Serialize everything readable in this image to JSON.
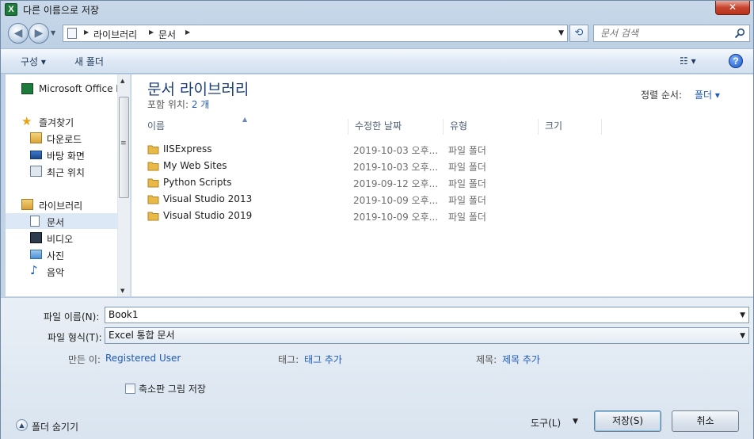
{
  "window": {
    "title": "다른 이름으로 저장",
    "app_icon_letter": "X",
    "close_glyph": "✕"
  },
  "address": {
    "breadcrumbs": [
      "라이브러리",
      "문서"
    ],
    "search_placeholder": "문서 검색"
  },
  "toolbar": {
    "organize_label": "구성 ▾",
    "new_folder_label": "새 폴더",
    "view_label": "☷ ▾",
    "help_label": "?"
  },
  "nav_pane": {
    "items": [
      {
        "label": "Microsoft Office Excel",
        "icon": "excel-icon"
      },
      {
        "label": "즐겨찾기",
        "icon": "star-icon"
      },
      {
        "label": "다운로드",
        "icon": "download-icon"
      },
      {
        "label": "바탕 화면",
        "icon": "desktop-icon"
      },
      {
        "label": "최근 위치",
        "icon": "recent-places-icon"
      },
      {
        "label": "라이브러리",
        "icon": "library-icon"
      },
      {
        "label": "문서",
        "icon": "document-icon",
        "selected": true
      },
      {
        "label": "비디오",
        "icon": "video-icon"
      },
      {
        "label": "사진",
        "icon": "picture-icon"
      },
      {
        "label": "음악",
        "icon": "music-icon"
      }
    ]
  },
  "file_pane": {
    "library_title": "문서 라이브러리",
    "includes_label": "포함 위치:",
    "includes_count": "2 개",
    "sort_label": "정렬 순서:",
    "sort_value": "폴더 ▾",
    "columns": [
      "이름",
      "수정한 날짜",
      "유형",
      "크기"
    ],
    "rows": [
      {
        "name": "IISExpress",
        "date": "2019-10-03 오후...",
        "type": "파일 폴더"
      },
      {
        "name": "My Web Sites",
        "date": "2019-10-03 오후...",
        "type": "파일 폴더"
      },
      {
        "name": "Python Scripts",
        "date": "2019-09-12 오후...",
        "type": "파일 폴더"
      },
      {
        "name": "Visual Studio 2013",
        "date": "2019-10-09 오후...",
        "type": "파일 폴더"
      },
      {
        "name": "Visual Studio 2019",
        "date": "2019-10-09 오후...",
        "type": "파일 폴더"
      }
    ]
  },
  "form": {
    "filename_label": "파일 이름(N):",
    "filename_value": "Book1",
    "filetype_label": "파일 형식(T):",
    "filetype_value": "Excel 통합 문서",
    "author_label": "만든 이:",
    "author_value": "Registered User",
    "tags_label": "태그:",
    "tags_value": "태그 추가",
    "title_label": "제목:",
    "title_value": "제목 추가",
    "thumbnail_label": "축소판 그림 저장",
    "hide_folders_label": "폴더 숨기기",
    "tools_label": "도구(L)",
    "save_label": "저장(S)",
    "cancel_label": "취소"
  },
  "colors": {
    "accent_link": "#1f5bb5",
    "library_title": "#1e3f7a",
    "close_button": "#c7452f"
  }
}
